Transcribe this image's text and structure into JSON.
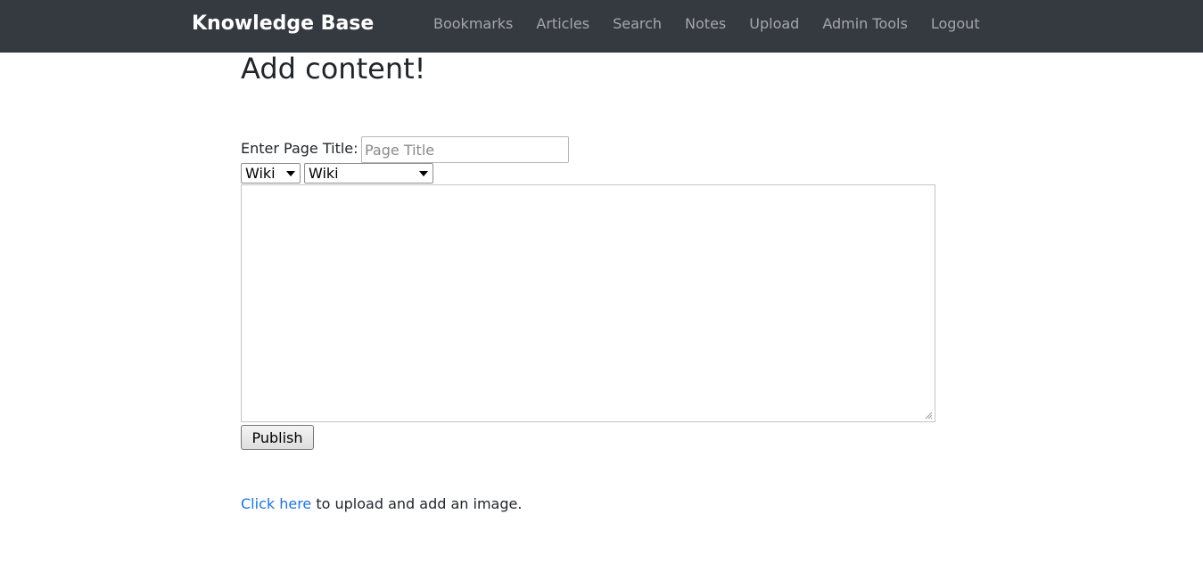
{
  "navbar": {
    "brand": "Knowledge Base",
    "links": [
      {
        "label": "Bookmarks"
      },
      {
        "label": "Articles"
      },
      {
        "label": "Search"
      },
      {
        "label": "Notes"
      },
      {
        "label": "Upload"
      },
      {
        "label": "Admin Tools"
      },
      {
        "label": "Logout"
      }
    ]
  },
  "main": {
    "heading": "Add content!",
    "title_label": "Enter Page Title:",
    "title_placeholder": "Page Title",
    "title_value": "",
    "select_1_value": "Wiki",
    "select_2_value": "Wiki",
    "editor_value": "",
    "publish_label": "Publish",
    "upload_link_text": "Click here",
    "upload_suffix": " to upload and add an image."
  },
  "colors": {
    "navbar_bg": "#343a40",
    "link_blue": "#1a73e8"
  }
}
